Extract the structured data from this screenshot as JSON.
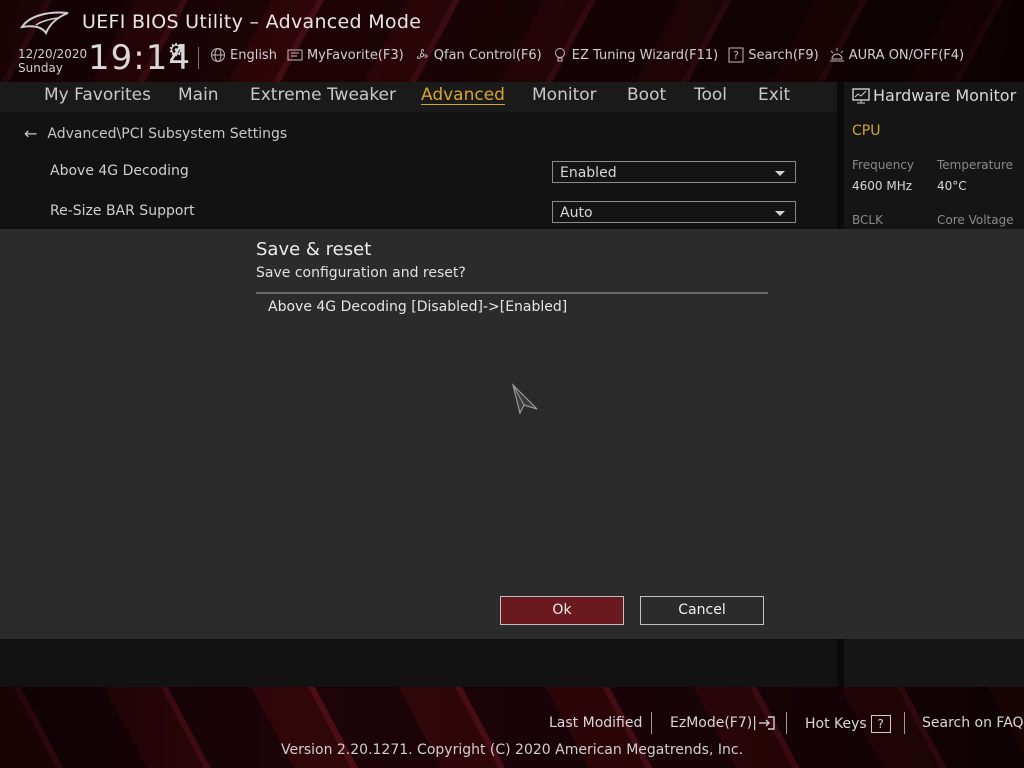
{
  "header": {
    "title": "UEFI BIOS Utility – Advanced Mode",
    "date": "12/20/2020",
    "day": "Sunday",
    "time": "19:14",
    "tools": [
      {
        "label": "English",
        "icon": "globe-icon"
      },
      {
        "label": "MyFavorite(F3)",
        "icon": "favorite-icon"
      },
      {
        "label": "Qfan Control(F6)",
        "icon": "fan-icon"
      },
      {
        "label": "EZ Tuning Wizard(F11)",
        "icon": "bulb-icon"
      },
      {
        "label": "Search(F9)",
        "icon": "search-help-icon"
      },
      {
        "label": "AURA ON/OFF(F4)",
        "icon": "aura-icon"
      }
    ]
  },
  "nav": {
    "items": [
      "My Favorites",
      "Main",
      "Extreme Tweaker",
      "Advanced",
      "Monitor",
      "Boot",
      "Tool",
      "Exit"
    ],
    "active": "Advanced"
  },
  "main": {
    "breadcrumb": "Advanced\\PCI Subsystem Settings",
    "settings": [
      {
        "label": "Above 4G Decoding",
        "value": "Enabled"
      },
      {
        "label": "Re-Size BAR Support",
        "value": "Auto"
      }
    ]
  },
  "hardware_monitor": {
    "title": "Hardware Monitor",
    "section": "CPU",
    "frequency_label": "Frequency",
    "frequency_value": "4600 MHz",
    "temperature_label": "Temperature",
    "temperature_value": "40°C",
    "bclk_label": "BCLK",
    "core_voltage_label": "Core Voltage"
  },
  "dialog": {
    "title": "Save & reset",
    "subtitle": "Save configuration and reset?",
    "change": "Above 4G Decoding [Disabled]->[Enabled]",
    "ok_label": "Ok",
    "cancel_label": "Cancel"
  },
  "footer": {
    "last_modified": "Last Modified",
    "ezmode": "EzMode(F7)|",
    "hot_keys": "Hot Keys",
    "hot_keys_key": "?",
    "search_faq": "Search on FAQ",
    "copyright": "Version 2.20.1271. Copyright (C) 2020 American Megatrends, Inc."
  },
  "colors": {
    "accent": "#d6a531",
    "ok_button": "#6a1a1f",
    "dialog_bg": "#2b2b2b"
  }
}
